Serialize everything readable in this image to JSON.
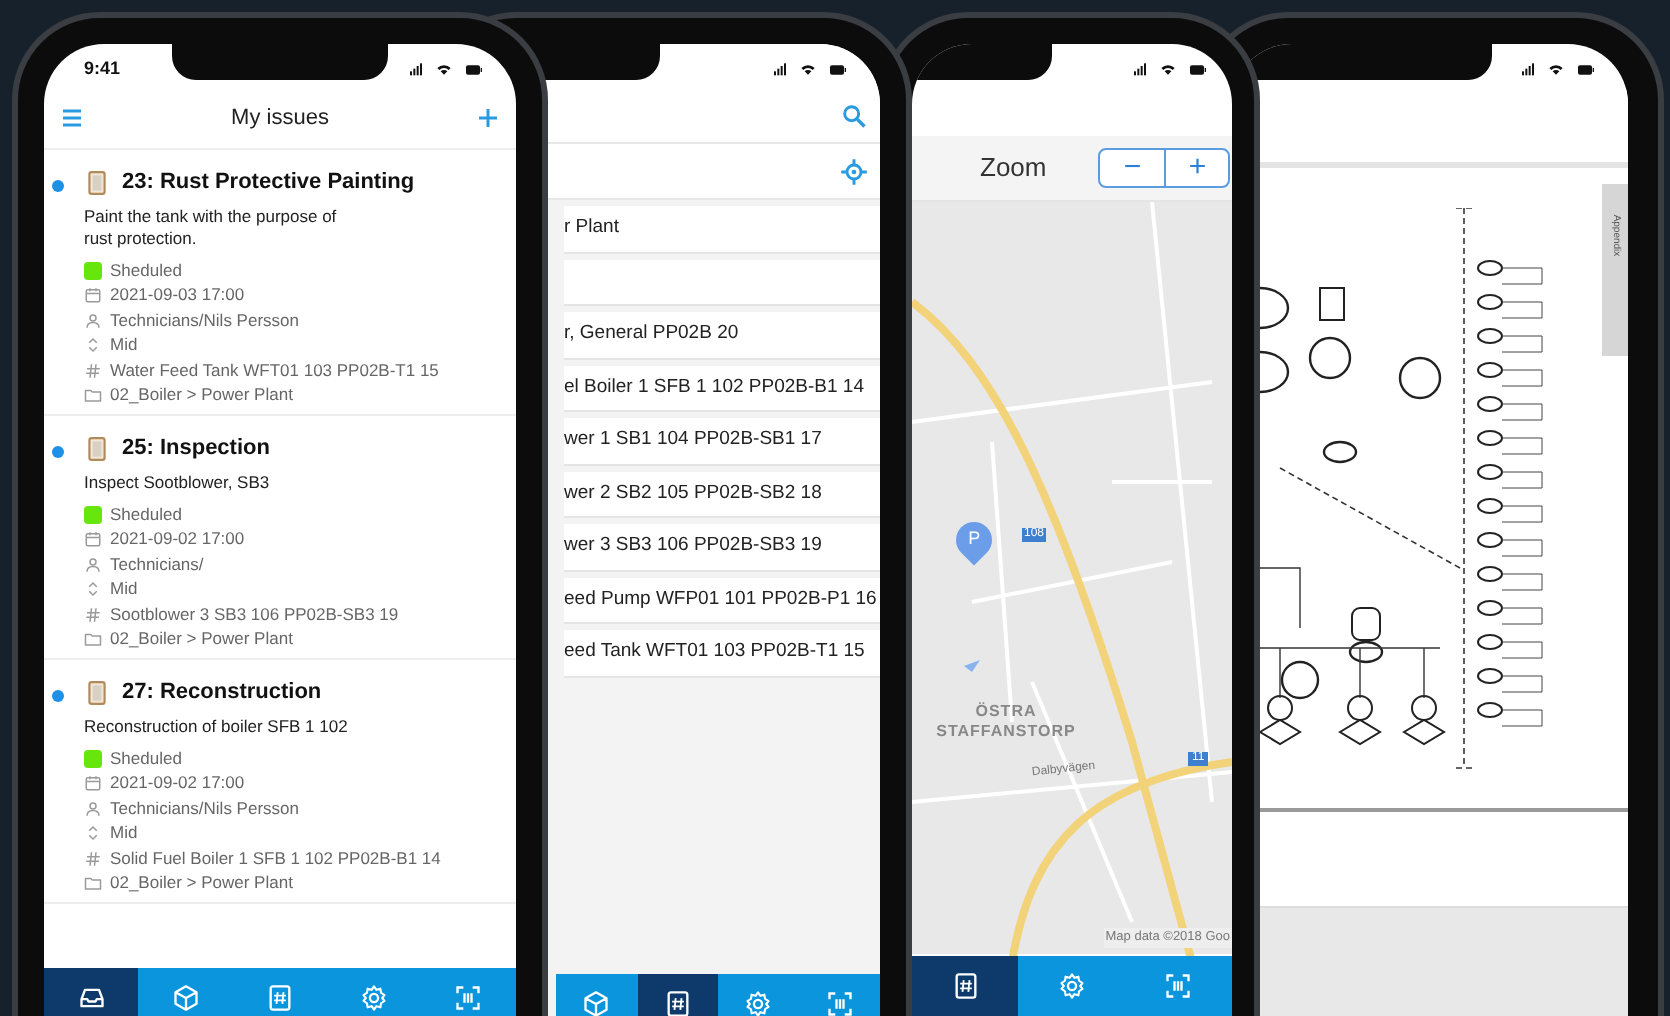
{
  "phones": [
    {
      "kind": "issues",
      "status": {
        "time": "9:41"
      },
      "header": {
        "title": "My issues"
      },
      "issues": [
        {
          "unread": true,
          "title": "23: Rust Protective Painting",
          "description": "Paint the tank with the purpose of rust protection.",
          "state": "Sheduled",
          "color": "#66e60a",
          "date": "2021-09-03 17:00",
          "assignee": "Technicians/Nils Persson",
          "priority": "Mid",
          "asset": "Water Feed Tank WFT01 103 PP02B-T1 15",
          "location": "02_Boiler > Power Plant"
        },
        {
          "unread": true,
          "title": "25: Inspection",
          "description": "Inspect Sootblower, SB3",
          "state": "Sheduled",
          "color": "#66e60a",
          "date": "2021-09-02 17:00",
          "assignee": "Technicians/",
          "priority": "Mid",
          "asset": "Sootblower 3 SB3 106 PP02B-SB3 19",
          "location": "02_Boiler > Power Plant"
        },
        {
          "unread": true,
          "title": "27: Reconstruction",
          "description": "Reconstruction of boiler SFB 1 102",
          "state": "Sheduled",
          "color": "#66e60a",
          "date": "2021-09-02 17:00",
          "assignee": "Technicians/Nils Persson",
          "priority": "Mid",
          "asset": "Solid Fuel Boiler 1 SFB 1 102 PP02B-B1 14",
          "location": "02_Boiler > Power Plant"
        }
      ],
      "tabs": [
        {
          "kind": "inbox",
          "selected": true
        },
        {
          "kind": "cube",
          "selected": false
        },
        {
          "kind": "tag",
          "selected": false
        },
        {
          "kind": "gear",
          "selected": false
        },
        {
          "kind": "scan",
          "selected": false
        }
      ]
    },
    {
      "kind": "asset_list",
      "rows": [
        "r Plant",
        "",
        "r, General PP02B 20",
        "el Boiler 1 SFB 1 102 PP02B-B1 14",
        "wer 1 SB1 104 PP02B-SB1 17",
        "wer 2 SB2 105 PP02B-SB2 18",
        "wer 3 SB3 106 PP02B-SB3 19",
        "eed Pump WFP01 101 PP02B-P1 16",
        "eed Tank WFT01 103 PP02B-T1 15"
      ],
      "tabs": [
        {
          "kind": "cube",
          "selected": false
        },
        {
          "kind": "tag",
          "selected": true
        },
        {
          "kind": "gear",
          "selected": false
        },
        {
          "kind": "scan",
          "selected": false
        }
      ]
    },
    {
      "kind": "map",
      "header": {
        "title": "Zoom",
        "buttons": [
          "−",
          "+"
        ]
      },
      "map": {
        "district": "ÖSTRA STAFFANSTORP",
        "street": "Dalbyvägen",
        "road_shields": [
          "108",
          "11"
        ],
        "marker": "P",
        "attribution": "Map data ©2018 Goo"
      },
      "tabs": [
        {
          "kind": "tag",
          "selected": true
        },
        {
          "kind": "gear",
          "selected": false
        },
        {
          "kind": "scan",
          "selected": false
        }
      ]
    },
    {
      "kind": "document",
      "side_tab": "Appendix"
    }
  ]
}
